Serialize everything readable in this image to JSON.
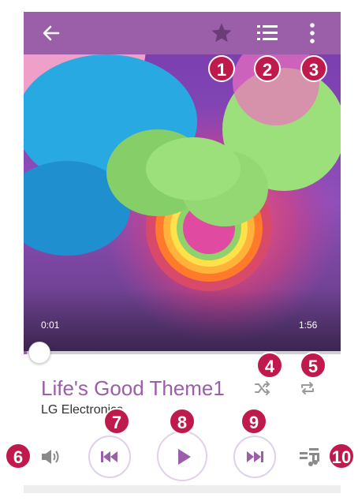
{
  "player": {
    "elapsed": "0:01",
    "duration": "1:56",
    "progress": 0.01,
    "title": "Life's Good Theme1",
    "artist": "LG Electronics",
    "accent_color": "#9b5ea8"
  },
  "topbar": {
    "icons": [
      "back-arrow-icon",
      "star-icon",
      "playlist-icon",
      "more-vert-icon"
    ]
  },
  "controls": {
    "icons": [
      "volume-icon",
      "previous-icon",
      "play-icon",
      "next-icon",
      "equalizer-icon",
      "shuffle-icon",
      "repeat-icon"
    ]
  },
  "callouts": [
    "1",
    "2",
    "3",
    "4",
    "5",
    "6",
    "7",
    "8",
    "9",
    "10"
  ],
  "callout_color": "#c01a4d"
}
